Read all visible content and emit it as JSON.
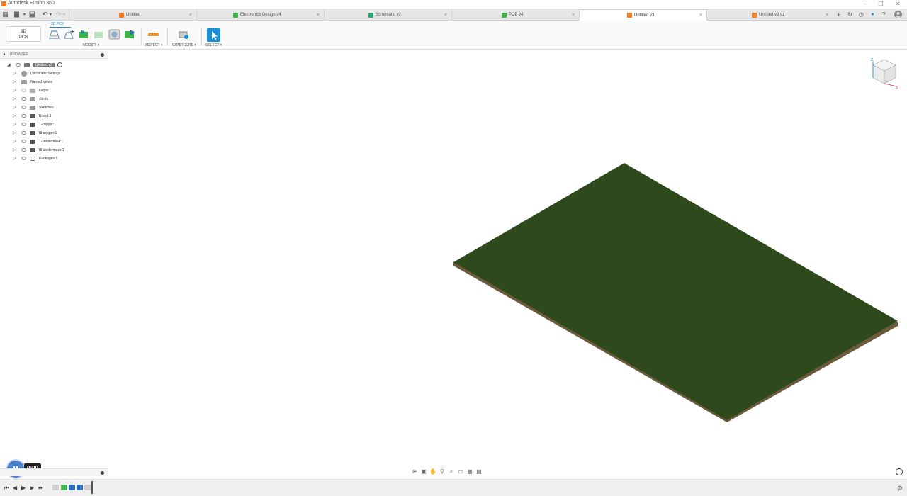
{
  "window": {
    "title": "Autodesk Fusion 360",
    "controls": [
      "–",
      "❐",
      "✕"
    ]
  },
  "tabbar": {
    "tabs": [
      {
        "label": "Untitled",
        "icon": "orange-cube-icon",
        "color": "#f47b20",
        "active": false
      },
      {
        "label": "Electronics Design v4",
        "icon": "electronics-icon",
        "color": "#3bb24a",
        "active": false
      },
      {
        "label": "Schematic v2",
        "icon": "schematic-icon",
        "color": "#2aa876",
        "active": false
      },
      {
        "label": "PCB v4",
        "icon": "pcb-icon",
        "color": "#3bb24a",
        "active": false
      },
      {
        "label": "Untitled v3",
        "icon": "orange-cube-icon",
        "color": "#f47b20",
        "active": true
      },
      {
        "label": "Untitled v3 v1",
        "icon": "orange-cube-icon",
        "color": "#f47b20",
        "active": false
      }
    ],
    "close_glyph": "×"
  },
  "toolbar": {
    "workspace": {
      "line1": "3D",
      "line2": "PCB"
    },
    "active_tab": "3D PCB",
    "groups": {
      "modify": "MODIFY ▾",
      "inspect": "INSPECT ▾",
      "configure": "CONFIGURE ▾",
      "select": "SELECT ▾"
    }
  },
  "browser": {
    "title": "BROWSER",
    "root": "Untitled v3",
    "items": [
      {
        "label": "Document Settings",
        "icon": "gear-icon"
      },
      {
        "label": "Named Views",
        "icon": "folder-icon"
      },
      {
        "label": "Origin",
        "icon": "folder-icon"
      },
      {
        "label": "Joints",
        "icon": "folder-icon"
      },
      {
        "label": "Sketches",
        "icon": "folder-icon"
      },
      {
        "label": "Board:1",
        "icon": "body-icon"
      },
      {
        "label": "1-copper:1",
        "icon": "body-icon"
      },
      {
        "label": "f8-copper:1",
        "icon": "body-icon"
      },
      {
        "label": "1-soldermask:1",
        "icon": "body-icon"
      },
      {
        "label": "f8-soldermask:1",
        "icon": "body-icon"
      },
      {
        "label": "Packages:1",
        "icon": "component-icon"
      }
    ]
  },
  "viewport": {
    "board_top_color": "#2e4a1d",
    "board_edge_color": "#6b5a3c",
    "viewcube_labels": {
      "z": "Z",
      "x": "X",
      "y": "Y"
    }
  },
  "playback": {
    "timecode": "0:00",
    "state": "paused"
  },
  "colors": {
    "accent": "#1a8fd6",
    "fusion_orange": "#f47b20"
  }
}
